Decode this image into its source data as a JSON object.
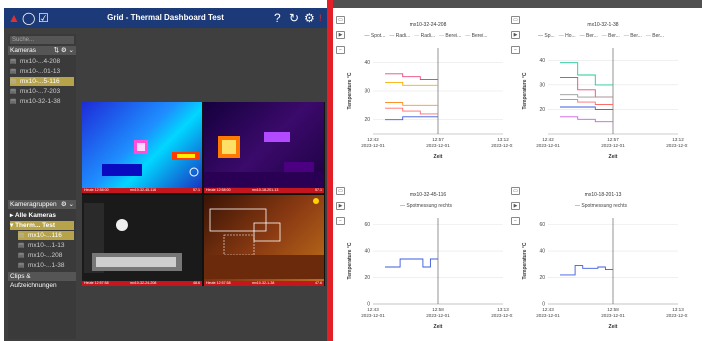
{
  "app": {
    "title": "Grid - Thermal Dashboard Test",
    "search_placeholder": "Suche...",
    "sections": {
      "cameras": "Kameras",
      "camera_groups": "Kameragruppen",
      "clips": "Clips & Aufzeichnungen"
    },
    "camera_list": [
      {
        "label": "mx10-...4-208",
        "selected": false
      },
      {
        "label": "mx10-...01-13",
        "selected": false
      },
      {
        "label": "mx10-...5-116",
        "selected": true
      },
      {
        "label": "mx10-...7-203",
        "selected": false
      },
      {
        "label": "mx10-32-1-38",
        "selected": false
      }
    ],
    "groups": [
      {
        "label": "Alle Kameras",
        "selected": false
      },
      {
        "label": "Therm... Test",
        "selected": true
      }
    ],
    "group_items": [
      {
        "label": "mx10-...116",
        "selected": true
      },
      {
        "label": "mx10-...1-13",
        "selected": false
      },
      {
        "label": "mx10-...208",
        "selected": false
      },
      {
        "label": "mx10-...1-38",
        "selected": false
      }
    ],
    "camera_tiles": [
      {
        "time": "Heute 12:58:00",
        "name": "mx10-32-45-116",
        "extra": "57.1"
      },
      {
        "time": "Heute 12:58:00",
        "name": "mx10-18-201-13",
        "extra": "57.1"
      },
      {
        "time": "Heute 12:57:58",
        "name": "mx10-32-24-208",
        "extra": "48.6"
      },
      {
        "time": "Heute 12:57:58",
        "name": "mx10-32-1-38",
        "extra": "47.6"
      }
    ]
  },
  "charts": [
    {
      "title": "mx10-32-24-208",
      "legend": [
        "Spot...",
        "Radi...",
        "Radi...",
        "Berei...",
        "Berei..."
      ],
      "legend_colors": [
        "#3b5bdb",
        "#e64980",
        "#fab005",
        "#ff922b",
        "#ff6b6b"
      ],
      "ylabel": "Temperature °C",
      "xlabel": "Zeit",
      "yticks": [
        "20",
        "30",
        "40"
      ],
      "xticks": [
        [
          "12:42",
          "2023-12-01"
        ],
        [
          "12:57",
          "2023-12-01"
        ],
        [
          "13:12",
          "2023-12-01"
        ]
      ]
    },
    {
      "title": "mx10-32-1-38",
      "legend": [
        "Sp...",
        "Ho...",
        "Ber...",
        "Ber...",
        "Ber...",
        "Ber..."
      ],
      "legend_colors": [
        "#3b5bdb",
        "#cc5de8",
        "#e64980",
        "#ff6b6b",
        "#20c997",
        "#999999"
      ],
      "ylabel": "Temperature °C",
      "xlabel": "Zeit",
      "yticks": [
        "20",
        "30",
        "40"
      ],
      "xticks": [
        [
          "12:42",
          "2023-12-01"
        ],
        [
          "12:57",
          "2023-12-01"
        ],
        [
          "13:12",
          "2023-12-01"
        ]
      ]
    },
    {
      "title": "mx10-32-45-116",
      "legend": [
        "Spotmessung rechts"
      ],
      "legend_colors": [
        "#3b5bdb"
      ],
      "ylabel": "Temperature °C",
      "xlabel": "Zeit",
      "yticks": [
        "0",
        "20",
        "40",
        "60"
      ],
      "xticks": [
        [
          "12:43",
          "2023-12-01"
        ],
        [
          "12:58",
          "2023-12-01"
        ],
        [
          "13:13",
          "2023-12-01"
        ]
      ]
    },
    {
      "title": "mx10-18-201-13",
      "legend": [
        "Spotmessung rechts"
      ],
      "legend_colors": [
        "#3b5bdb"
      ],
      "ylabel": "Temperature °C",
      "xlabel": "Zeit",
      "yticks": [
        "0",
        "20",
        "40",
        "60"
      ],
      "xticks": [
        [
          "12:43",
          "2023-12-01"
        ],
        [
          "12:58",
          "2023-12-01"
        ],
        [
          "13:13",
          "2023-12-01"
        ]
      ]
    }
  ],
  "chart_data": [
    {
      "type": "line",
      "title": "mx10-32-24-208",
      "ylabel": "Temperature °C",
      "xlabel": "Zeit",
      "ylim": [
        15,
        45
      ],
      "x": [
        "12:50",
        "12:53",
        "12:56",
        "12:57"
      ],
      "series": [
        {
          "name": "Spot...",
          "values": [
            20,
            21,
            21,
            20
          ]
        },
        {
          "name": "Radi...",
          "values": [
            36,
            35,
            34,
            36
          ]
        },
        {
          "name": "Radi...",
          "values": [
            33,
            32,
            32,
            31
          ]
        },
        {
          "name": "Berei...",
          "values": [
            26,
            25,
            25,
            34
          ]
        },
        {
          "name": "Berei...",
          "values": [
            24,
            23,
            22,
            23
          ]
        }
      ]
    },
    {
      "type": "line",
      "title": "mx10-32-1-38",
      "ylabel": "Temperature °C",
      "xlabel": "Zeit",
      "ylim": [
        10,
        45
      ],
      "x": [
        "12:50",
        "12:53",
        "12:56",
        "12:57"
      ],
      "series": [
        {
          "name": "Sp...",
          "values": [
            21,
            21,
            20,
            21
          ]
        },
        {
          "name": "Ho...",
          "values": [
            17,
            16,
            15,
            16
          ]
        },
        {
          "name": "Ber...",
          "values": [
            33,
            28,
            25,
            30
          ]
        },
        {
          "name": "Ber...",
          "values": [
            24,
            23,
            22,
            23
          ]
        },
        {
          "name": "Ber...",
          "values": [
            39,
            34,
            30,
            36
          ]
        },
        {
          "name": "Ber...",
          "values": [
            26,
            25,
            25,
            26
          ]
        }
      ]
    },
    {
      "type": "line",
      "title": "mx10-32-45-116",
      "ylabel": "Temperature °C",
      "xlabel": "Zeit",
      "ylim": [
        0,
        65
      ],
      "x": [
        "12:51",
        "12:52",
        "12:53",
        "12:54",
        "12:55",
        "12:56",
        "12:57",
        "12:58"
      ],
      "series": [
        {
          "name": "Spotmessung rechts",
          "values": [
            28,
            28,
            34,
            34,
            34,
            28,
            34,
            34
          ]
        }
      ]
    },
    {
      "type": "line",
      "title": "mx10-18-201-13",
      "ylabel": "Temperature °C",
      "xlabel": "Zeit",
      "ylim": [
        0,
        65
      ],
      "x": [
        "12:51",
        "12:52",
        "12:53",
        "12:54",
        "12:55",
        "12:56",
        "12:57",
        "12:58"
      ],
      "series": [
        {
          "name": "Spotmessung rechts",
          "values": [
            22,
            22,
            29,
            27,
            27,
            28,
            26,
            28
          ]
        }
      ]
    }
  ]
}
